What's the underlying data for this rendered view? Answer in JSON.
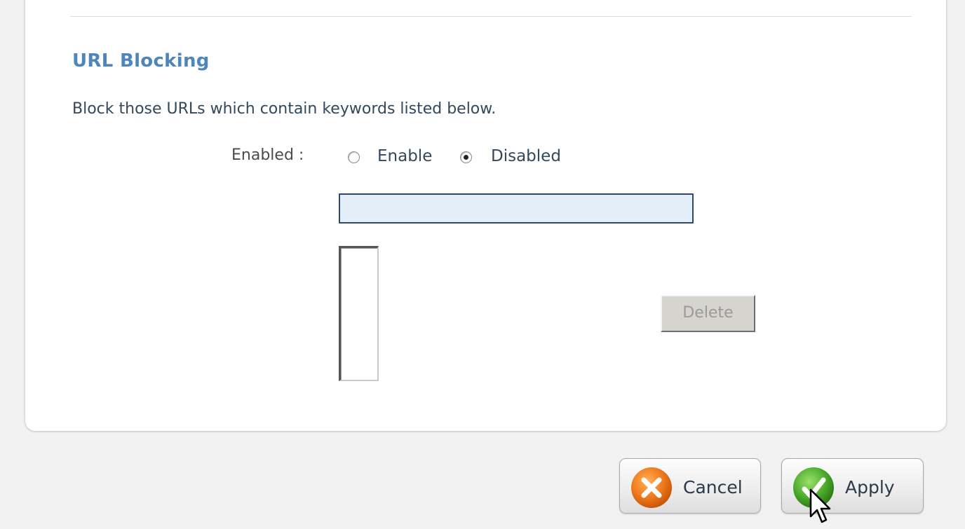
{
  "section": {
    "title": "URL Blocking",
    "description": "Block those URLs which contain keywords listed below."
  },
  "enabled_field": {
    "label": "Enabled :",
    "options": [
      {
        "label": "Enable",
        "checked": false
      },
      {
        "label": "Disabled",
        "checked": true
      }
    ]
  },
  "keyword_input": {
    "value": "",
    "placeholder": ""
  },
  "keyword_list": {
    "items": []
  },
  "buttons": {
    "delete_label": "Delete",
    "cancel_label": "Cancel",
    "apply_label": "Apply"
  },
  "icons": {
    "cancel": "x-circle-icon",
    "apply": "checkmark-circle-icon",
    "pointer": "mouse-pointer-icon"
  },
  "colors": {
    "title": "#4d86bd",
    "text": "#33485c",
    "input_bg": "#e4eef9",
    "cancel_icon": "#f07a1c",
    "apply_icon": "#4fae2e"
  }
}
